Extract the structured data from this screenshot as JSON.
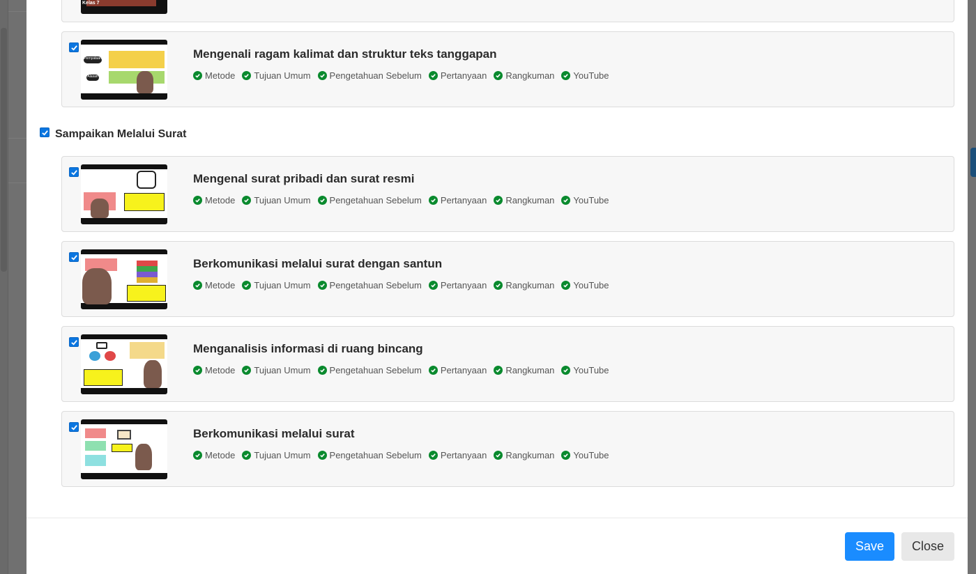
{
  "tags": [
    "Metode",
    "Tujuan Umum",
    "Pengetahuan Sebelum",
    "Pertanyaan",
    "Rangkuman",
    "YouTube"
  ],
  "top_card": {
    "thumb_text": "Kelas 7"
  },
  "lesson_prev": {
    "title": "Mengenali ragam kalimat dan struktur teks tanggapan",
    "thumb_labels": [
      "Pernyataan",
      "Alasan"
    ]
  },
  "section": {
    "title": "Sampaikan Melalui Surat"
  },
  "lessons": [
    {
      "title": "Mengenal surat pribadi dan surat resmi"
    },
    {
      "title": "Berkomunikasi melalui surat dengan santun"
    },
    {
      "title": "Menganalisis informasi di ruang bincang"
    },
    {
      "title": "Berkomunikasi melalui surat"
    }
  ],
  "footer": {
    "save_label": "Save",
    "close_label": "Close"
  },
  "colors": {
    "primary": "#1a8cff",
    "check": "#0a8a2e",
    "checkbox": "#0b76e0"
  }
}
